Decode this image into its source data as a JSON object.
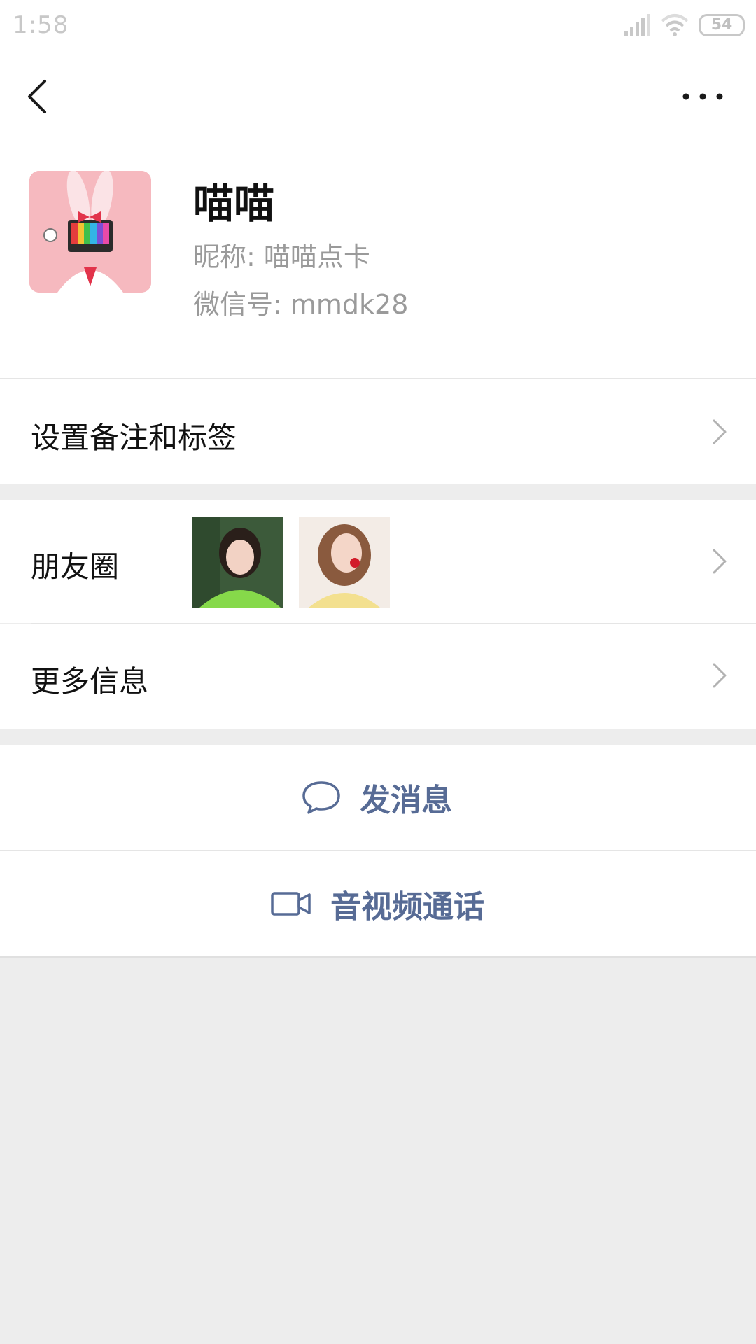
{
  "status_bar": {
    "time": "1:58",
    "battery": "54",
    "icons": [
      "signal-icon",
      "wifi-icon",
      "battery-icon"
    ]
  },
  "nav": {
    "back_icon": "chevron-left-icon",
    "more_icon": "more-dots-icon"
  },
  "profile": {
    "name": "喵喵",
    "nickname": "昵称: 喵喵点卡",
    "wechat_id": "微信号: mmdk28"
  },
  "rows": {
    "remark": "设置备注和标签",
    "moments": "朋友圈",
    "more_info": "更多信息"
  },
  "actions": {
    "send_message": "发消息",
    "video_call": "音视频通话"
  },
  "colors": {
    "accent": "#576b95",
    "background": "#ededed",
    "avatar_bg": "#f6b9bf"
  }
}
